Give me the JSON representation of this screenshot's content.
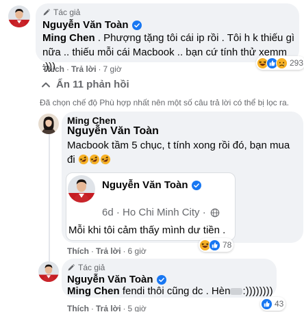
{
  "colors": {
    "bubble": "#f0f2f5",
    "secondary_text": "#65676b",
    "verified_blue": "#1877f2",
    "like_blue": "#1877f2",
    "haha_yellow": "#f7b125"
  },
  "comment1": {
    "badge": "Tác giả",
    "author": "Nguyễn Văn Toàn",
    "mention": "Ming Chen",
    "text_line1": " . Phượng tặng tôi cái ip rồi . Tôi h k thiếu gì",
    "text_line2": "nữa .. thiếu mỗi cái Macbook .. bạn cứ tính thử xemm :)))",
    "actions": {
      "like": "Thích",
      "reply": "Trả lời",
      "time": "7 giờ"
    },
    "reactions": {
      "icons": [
        "haha-icon",
        "like-icon",
        "sad-icon"
      ],
      "count": "293"
    }
  },
  "hide_replies": {
    "icon": "chevron-up-icon",
    "label": "Ẩn 11 phản hồi"
  },
  "filter_note": "Đã chọn chế độ Phù hợp nhất nên một số câu trả lời có thể bị lọc ra.",
  "comment2": {
    "author": "Ming Chen",
    "mention": "Nguyễn Văn Toàn",
    "text_line1": "Macbook tầm 5 chục, t tính xong rồi đó, bạn mua",
    "text_line2": "đi",
    "emojis": [
      "rofl-icon",
      "rofl-icon",
      "rofl-icon"
    ],
    "shared": {
      "author": "Nguyễn Văn Toàn",
      "meta": "6d · Ho Chi Minh City ·",
      "meta_icon": "globe-icon",
      "text": "Mỗi khi tôi cảm thấy mình dư tiền ."
    },
    "actions": {
      "like": "Thích",
      "reply": "Trả lời",
      "time": "6 giờ"
    },
    "reactions": {
      "icons": [
        "haha-icon",
        "like-icon"
      ],
      "count": "78"
    }
  },
  "comment3": {
    "badge": "Tác giả",
    "author": "Nguyễn Văn Toàn",
    "mention": "Ming Chen",
    "text_before": " fendi thôi cũng dc . Hèn",
    "text_after": ":))))))))",
    "actions": {
      "like": "Thích",
      "reply": "Trả lời",
      "time": "5 giờ"
    },
    "reactions": {
      "icons": [
        "like-icon"
      ],
      "count": "43"
    }
  }
}
